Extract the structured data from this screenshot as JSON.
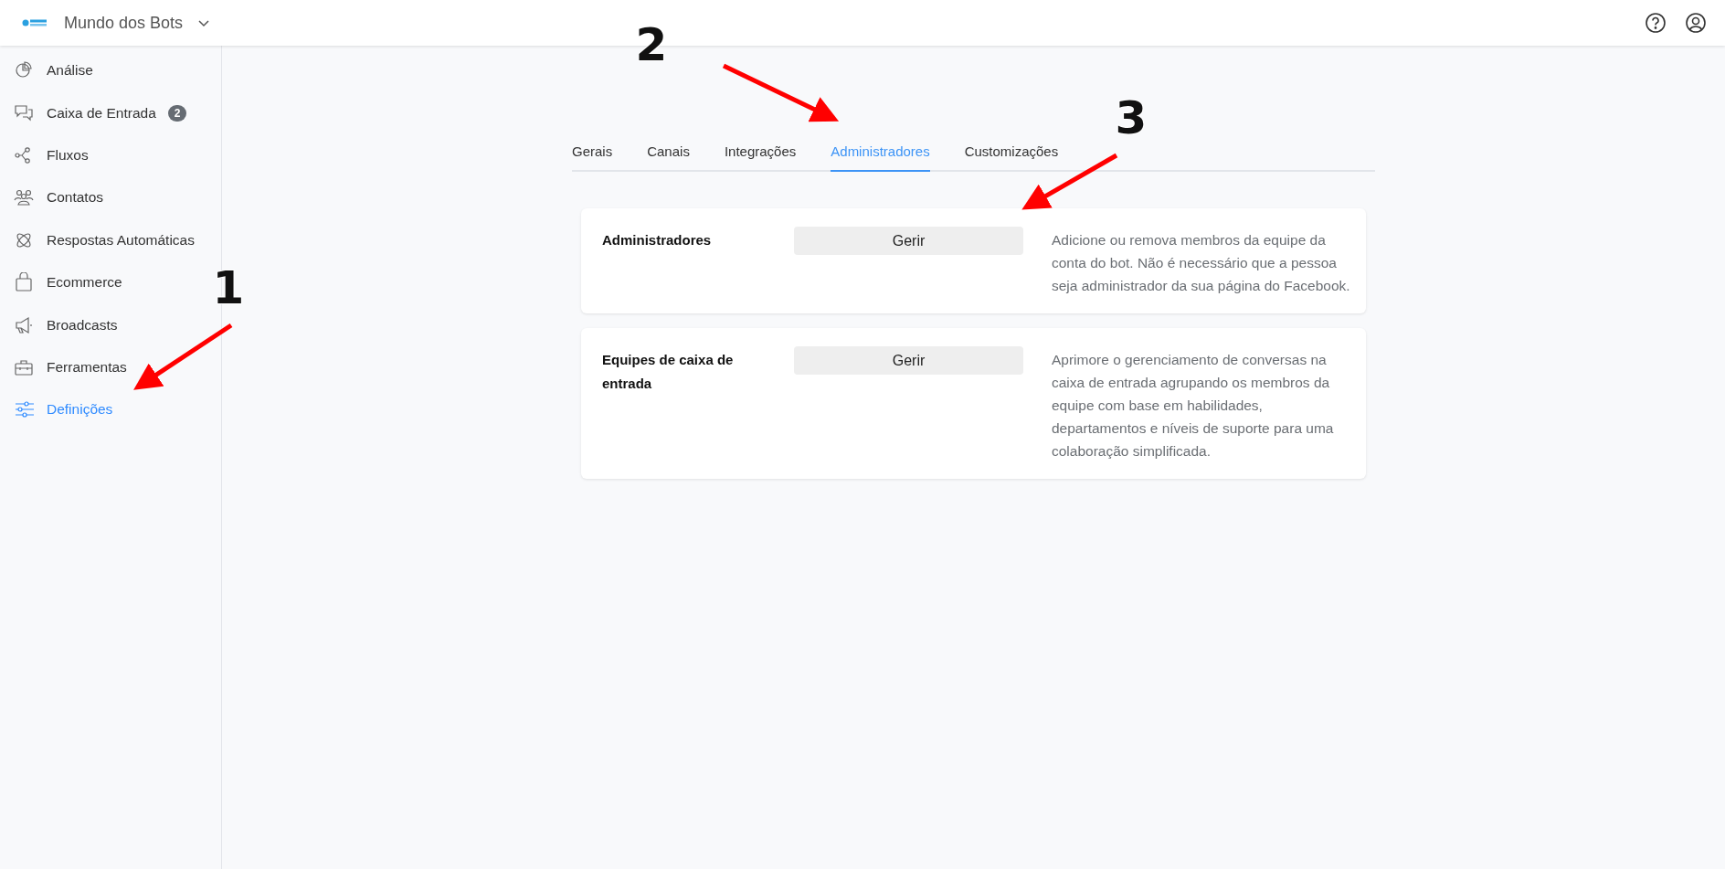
{
  "header": {
    "workspace": "Mundo dos Bots"
  },
  "sidebar": {
    "items": [
      {
        "kind": "chart",
        "label": "Análise",
        "selected": false
      },
      {
        "kind": "chat",
        "label": "Caixa de Entrada",
        "badge": "2",
        "selected": false
      },
      {
        "kind": "flow",
        "label": "Fluxos",
        "selected": false
      },
      {
        "kind": "people",
        "label": "Contatos",
        "selected": false
      },
      {
        "kind": "atom",
        "label": "Respostas Automáticas",
        "selected": false
      },
      {
        "kind": "bag",
        "label": "Ecommerce",
        "selected": false
      },
      {
        "kind": "megaphone",
        "label": "Broadcasts",
        "selected": false
      },
      {
        "kind": "toolbox",
        "label": "Ferramentas",
        "selected": false
      },
      {
        "kind": "sliders",
        "label": "Definições",
        "selected": true
      }
    ]
  },
  "tabs": [
    {
      "label": "Gerais",
      "selected": false
    },
    {
      "label": "Canais",
      "selected": false
    },
    {
      "label": "Integrações",
      "selected": false
    },
    {
      "label": "Administradores",
      "selected": true
    },
    {
      "label": "Customizações",
      "selected": false
    }
  ],
  "cards": [
    {
      "title": "Administradores",
      "button": "Gerir",
      "description": "Adicione ou remova membros da equipe da conta do bot. Não é necessário que a pessoa seja administrador da sua página do Facebook."
    },
    {
      "title": "Equipes de caixa de entrada",
      "button": "Gerir",
      "description": "Aprimore o gerenciamento de conversas na caixa de entrada agrupando os membros da equipe com base em habilidades, departamentos e níveis de suporte para uma colaboração simplificada."
    }
  ],
  "annotations": [
    {
      "label": "1"
    },
    {
      "label": "2"
    },
    {
      "label": "3"
    }
  ]
}
